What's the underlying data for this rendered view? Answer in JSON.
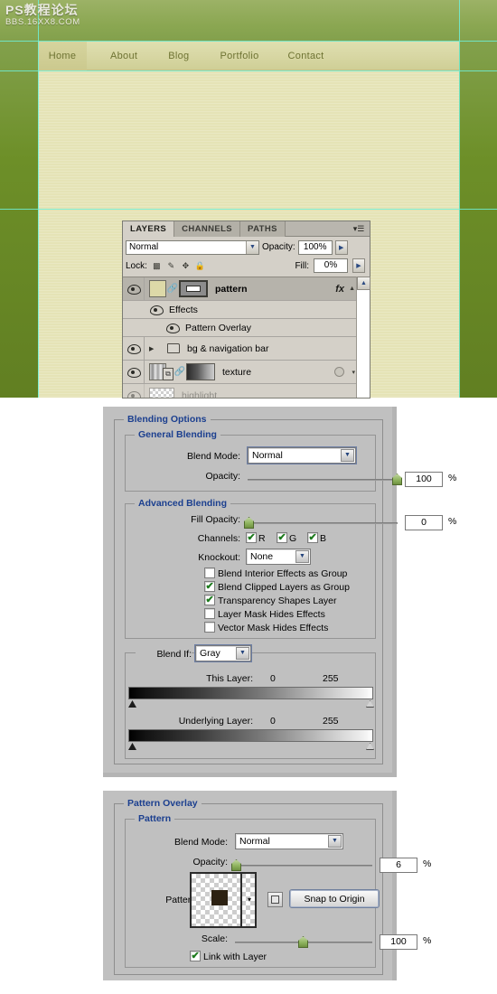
{
  "watermark": {
    "line1": "PS教程论坛",
    "line2": "BBS.16XX8.COM"
  },
  "mockup": {
    "nav": [
      {
        "label": "Home",
        "active": true
      },
      {
        "label": "About",
        "active": false
      },
      {
        "label": "Blog",
        "active": false
      },
      {
        "label": "Portfolio",
        "active": false
      },
      {
        "label": "Contact",
        "active": false
      }
    ],
    "colors": {
      "green_dark": "#617f22",
      "green_light": "#9cb266",
      "cream": "#e4e2b4",
      "nav_bar": "#d8d7a4",
      "nav_text": "#6e7332",
      "guide": "#6ff0d8"
    }
  },
  "layers_panel": {
    "tabs": [
      {
        "label": "LAYERS",
        "active": true
      },
      {
        "label": "CHANNELS",
        "active": false
      },
      {
        "label": "PATHS",
        "active": false
      }
    ],
    "menu_icon": "panel-menu-icon",
    "blend_mode": "Normal",
    "opacity_label": "Opacity:",
    "opacity_value": "100%",
    "lock_label": "Lock:",
    "fill_label": "Fill:",
    "fill_value": "0%",
    "lock_icons": [
      "transparency-lock-icon",
      "brush-lock-icon",
      "move-lock-icon",
      "lock-all-icon"
    ],
    "rows": [
      {
        "name": "pattern",
        "type": "layer",
        "selected": true,
        "visible": true,
        "has_fx": true,
        "bold": true
      },
      {
        "name": "Effects",
        "type": "effects-group",
        "selected": false,
        "visible": true,
        "indent": 1
      },
      {
        "name": "Pattern Overlay",
        "type": "effect",
        "selected": false,
        "visible": true,
        "indent": 2
      },
      {
        "name": "bg & navigation bar",
        "type": "group",
        "selected": false,
        "visible": true
      },
      {
        "name": "texture",
        "type": "layer-masked",
        "selected": false,
        "visible": true
      },
      {
        "name": "highlight",
        "type": "layer",
        "selected": false,
        "visible": false,
        "dim": true
      }
    ]
  },
  "blending_dialog": {
    "section_title": "Blending Options",
    "general": {
      "title": "General Blending",
      "blend_mode_label": "Blend Mode:",
      "blend_mode_value": "Normal",
      "opacity_label": "Opacity:",
      "opacity_value": "100",
      "opacity_unit": "%",
      "opacity_percent": 100
    },
    "advanced": {
      "title": "Advanced Blending",
      "fill_opacity_label": "Fill Opacity:",
      "fill_opacity_value": "0",
      "fill_opacity_unit": "%",
      "fill_opacity_percent": 0,
      "channels_label": "Channels:",
      "channels": [
        {
          "label": "R",
          "checked": true
        },
        {
          "label": "G",
          "checked": true
        },
        {
          "label": "B",
          "checked": true
        }
      ],
      "knockout_label": "Knockout:",
      "knockout_value": "None",
      "checkboxes": [
        {
          "label": "Blend Interior Effects as Group",
          "checked": false
        },
        {
          "label": "Blend Clipped Layers as Group",
          "checked": true
        },
        {
          "label": "Transparency Shapes Layer",
          "checked": true
        },
        {
          "label": "Layer Mask Hides Effects",
          "checked": false
        },
        {
          "label": "Vector Mask Hides Effects",
          "checked": false
        }
      ]
    },
    "blend_if": {
      "label": "Blend If:",
      "value": "Gray",
      "this_layer_label": "This Layer:",
      "this_layer_min": "0",
      "this_layer_max": "255",
      "underlying_label": "Underlying Layer:",
      "underlying_min": "0",
      "underlying_max": "255"
    }
  },
  "pattern_overlay_dialog": {
    "section_title": "Pattern Overlay",
    "group_title": "Pattern",
    "blend_mode_label": "Blend Mode:",
    "blend_mode_value": "Normal",
    "opacity_label": "Opacity:",
    "opacity_value": "6",
    "opacity_unit": "%",
    "opacity_percent": 6,
    "pattern_label": "Pattern:",
    "snap_button": "Snap to Origin",
    "new_preset_icon": "new-preset-icon",
    "scale_label": "Scale:",
    "scale_value": "100",
    "scale_unit": "%",
    "scale_percent": 100,
    "link_checkbox": {
      "label": "Link with Layer",
      "checked": true
    },
    "swatch_color": "#2c2112"
  }
}
